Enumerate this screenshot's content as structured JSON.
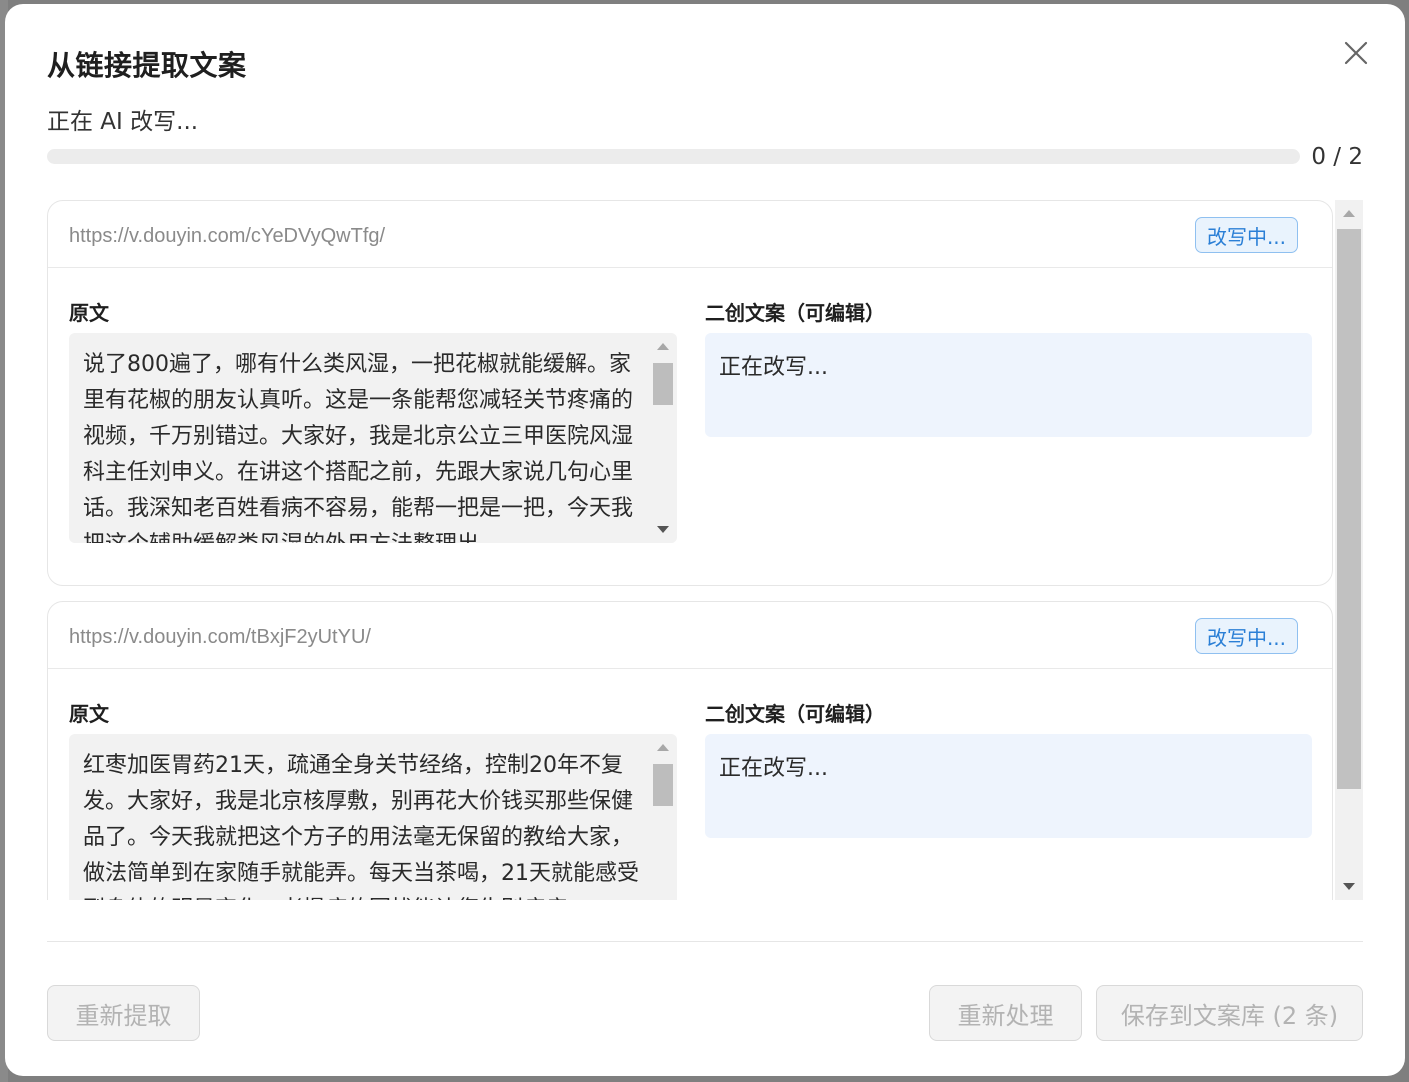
{
  "dialog": {
    "title": "从链接提取文案",
    "status": "正在 AI 改写...",
    "progress": {
      "label": "0 / 2",
      "fraction": 0
    }
  },
  "cards": [
    {
      "url": "https://v.douyin.com/cYeDVyQwTfg/",
      "badge": "改写中...",
      "original_label": "原文",
      "rewrite_label": "二创文案（可编辑）",
      "original_text": "说了800遍了，哪有什么类风湿，一把花椒就能缓解。家里有花椒的朋友认真听。这是一条能帮您减轻关节疼痛的视频，千万别错过。大家好，我是北京公立三甲医院风湿科主任刘申义。在讲这个搭配之前，先跟大家说几句心里话。我深知老百姓看病不容易，能帮一把是一把，今天我把这个辅助缓解类风湿的外用方法整理出",
      "rewrite_text": "正在改写..."
    },
    {
      "url": "https://v.douyin.com/tBxjF2yUtYU/",
      "badge": "改写中...",
      "original_label": "原文",
      "rewrite_label": "二创文案（可编辑）",
      "original_text": "红枣加医胃药21天，疏通全身关节经络，控制20年不复发。大家好，我是北京核厚敷，别再花大价钱买那些保健品了。今天我就把这个方子的用法毫无保留的教给大家，做法简单到在家随手就能弄。每天当茶喝，21天就能感受到身体的明显变化，老慢病的困扰能让您告别疼痛",
      "rewrite_text": "正在改写..."
    }
  ],
  "footer": {
    "retry_extract": "重新提取",
    "reprocess": "重新处理",
    "save": "保存到文案库 (2 条)"
  }
}
